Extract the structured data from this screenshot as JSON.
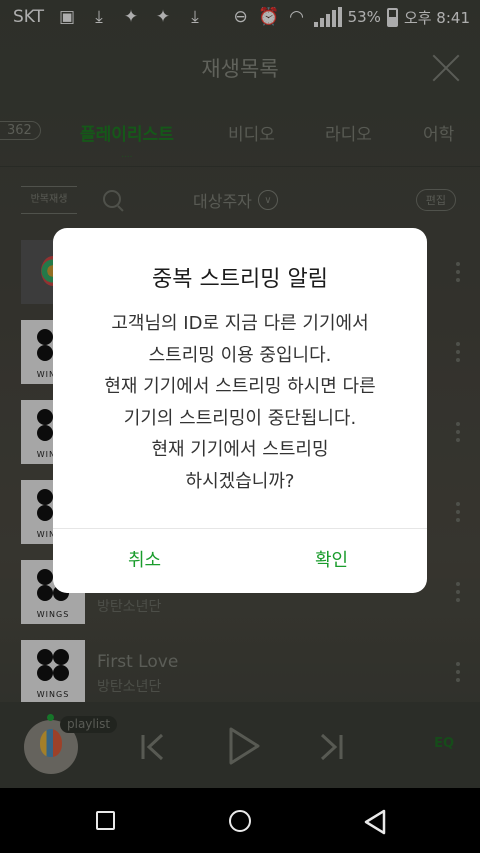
{
  "status_bar": {
    "carrier": "SKT",
    "battery": "53%",
    "time": "오후 8:41",
    "icons": [
      "chat-icon",
      "download-icon",
      "twitter-icon",
      "twitter-icon",
      "download-icon",
      "minus-circle-icon",
      "alarm-icon",
      "wifi-icon",
      "signal-icon",
      "battery-icon"
    ]
  },
  "header": {
    "title": "재생목록"
  },
  "tabs": {
    "count": "362",
    "items": [
      "플레이리스트",
      "비디오",
      "라디오",
      "어학"
    ],
    "active": "플레이리스트",
    "active_sub": "...."
  },
  "toolbar": {
    "repeat_label": "반복재생",
    "target_label": "대상주자",
    "edit_label": "편집"
  },
  "songs": [
    {
      "title": "",
      "artist": ""
    },
    {
      "title": "",
      "artist": ""
    },
    {
      "title": "",
      "artist": ""
    },
    {
      "title": "",
      "artist": ""
    },
    {
      "title": "",
      "artist": "방탄소년단",
      "album_label": "WINGS"
    },
    {
      "title": "First Love",
      "artist": "방탄소년단",
      "album_label": "WINGS"
    }
  ],
  "album_label": "WINGS",
  "player": {
    "playlist_label": "playlist",
    "eq_label": "EQ"
  },
  "dialog": {
    "title": "중복 스트리밍 알림",
    "lines": [
      "고객님의 ID로 지금 다른 기기에서",
      "스트리밍 이용 중입니다.",
      "현재 기기에서 스트리밍 하시면 다른",
      "기기의 스트리밍이 중단됩니다.",
      "현재 기기에서 스트리밍",
      "하시겠습니까?"
    ],
    "cancel": "취소",
    "confirm": "확인"
  },
  "colors": {
    "accent": "#1a9c2c",
    "dialog_bg": "#ffffff",
    "screen_bg": "#454740"
  }
}
